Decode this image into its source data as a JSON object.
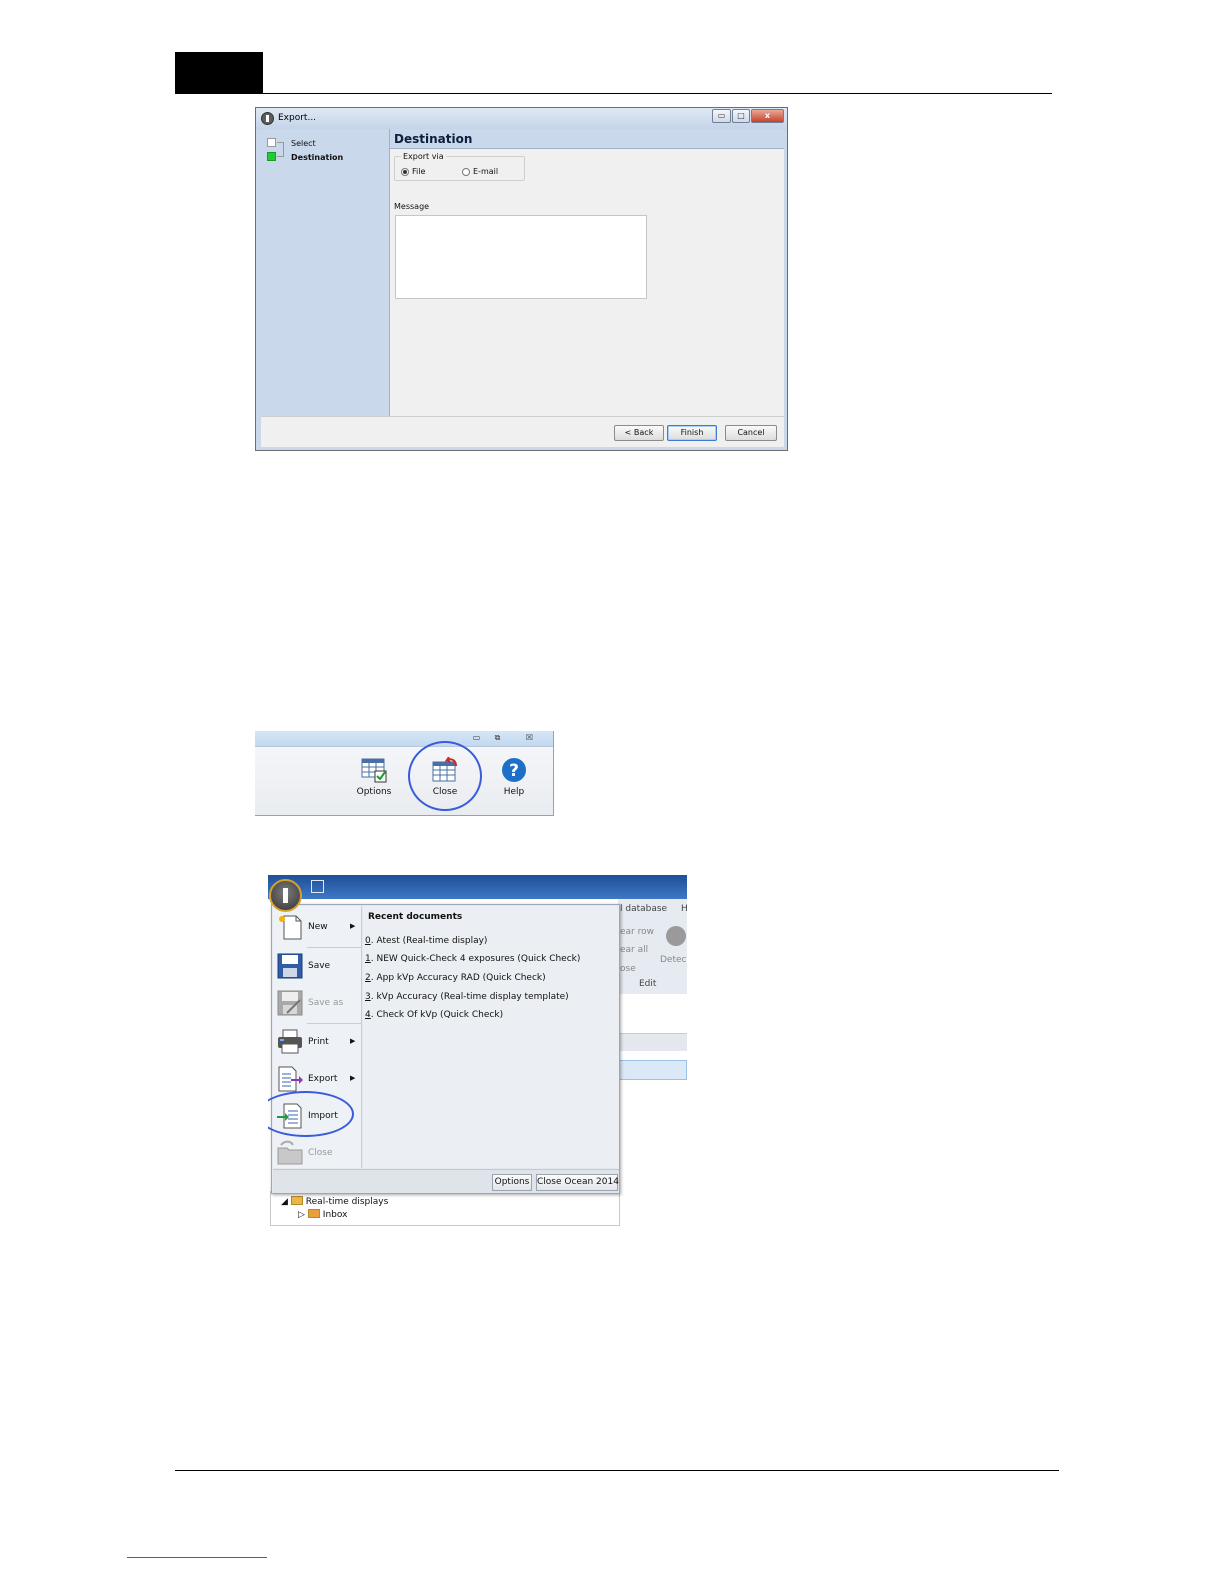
{
  "export_dialog": {
    "title": "Export...",
    "window_buttons": {
      "minimize": "▭",
      "maximize": "□",
      "close": "x"
    },
    "steps": [
      {
        "label": "Select",
        "active": false
      },
      {
        "label": "Destination",
        "active": true
      }
    ],
    "header": "Destination",
    "export_via": {
      "legend": "Export via",
      "options": [
        {
          "label": "File",
          "selected": true
        },
        {
          "label": "E-mail",
          "selected": false
        }
      ]
    },
    "message_label": "Message",
    "message_value": "",
    "buttons": {
      "back": "< Back",
      "finish": "Finish",
      "cancel": "Cancel"
    }
  },
  "ribbon": {
    "window_buttons": {
      "minimize": "▭",
      "restore": "⧉",
      "close": "☒"
    },
    "items": [
      {
        "label": "Options",
        "icon": "options-icon"
      },
      {
        "label": "Close",
        "icon": "close-document-icon"
      },
      {
        "label": "Help",
        "icon": "help-icon"
      }
    ]
  },
  "app_menu": {
    "background": {
      "tab_text": "l database",
      "tab_text2": "H",
      "group_items": [
        "ear row",
        "ear all",
        "ose"
      ],
      "detect_label": "Detect",
      "group_label": "Edit"
    },
    "items": [
      {
        "label": "New",
        "icon": "new-document-icon",
        "submenu": true,
        "disabled": false
      },
      {
        "label": "Save",
        "icon": "save-icon",
        "submenu": false,
        "disabled": false
      },
      {
        "label": "Save as",
        "icon": "save-as-icon",
        "submenu": false,
        "disabled": true
      },
      {
        "label": "Print",
        "icon": "print-icon",
        "submenu": true,
        "disabled": false
      },
      {
        "label": "Export",
        "icon": "export-icon",
        "submenu": true,
        "disabled": false
      },
      {
        "label": "Import",
        "icon": "import-icon",
        "submenu": false,
        "disabled": false
      },
      {
        "label": "Close",
        "icon": "folder-close-icon",
        "submenu": false,
        "disabled": true
      }
    ],
    "recent_title": "Recent documents",
    "recent": [
      {
        "key": "0",
        "text": ". Atest (Real-time display)"
      },
      {
        "key": "1",
        "text": ". NEW Quick-Check 4 exposures (Quick Check)"
      },
      {
        "key": "2",
        "text": ". App kVp Accuracy RAD (Quick Check)"
      },
      {
        "key": "3",
        "text": ". kVp Accuracy (Real-time display template)"
      },
      {
        "key": "4",
        "text": ". Check Of kVp (Quick Check)"
      }
    ],
    "footer": {
      "options": "Options",
      "close_app": "Close Ocean 2014"
    },
    "tree": {
      "root": "Real-time displays",
      "child": "Inbox"
    }
  }
}
